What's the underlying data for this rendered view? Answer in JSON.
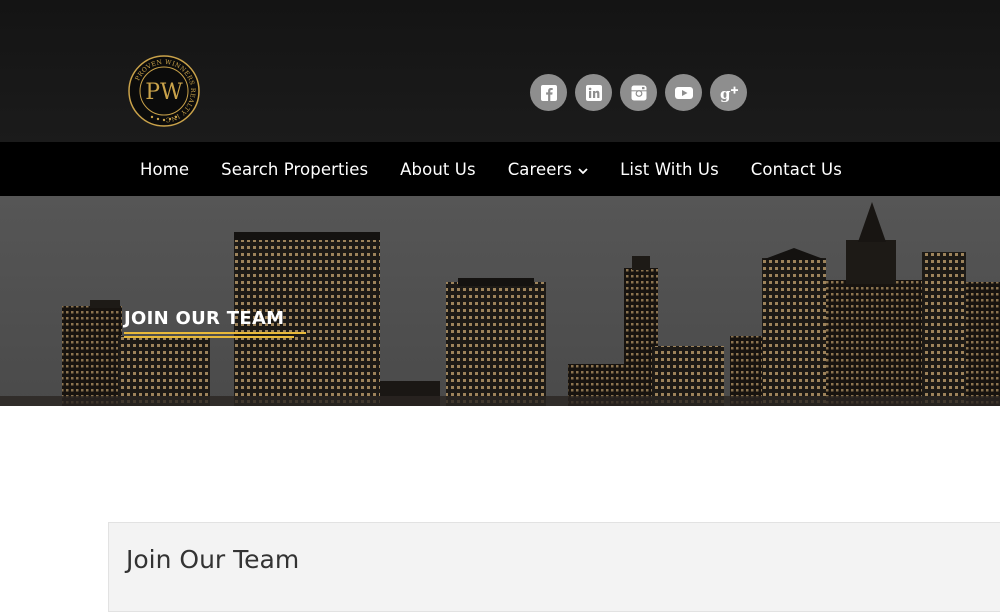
{
  "brand": {
    "logo_initials": "PW",
    "logo_ring_text": "PROVEN WINNERS REALTY",
    "logo_ring_suffix": "INC",
    "gold": "#c9a24a"
  },
  "social": [
    {
      "icon": "facebook-icon",
      "glyph": "f"
    },
    {
      "icon": "linkedin-icon",
      "glyph": "in"
    },
    {
      "icon": "instagram-icon",
      "glyph": ""
    },
    {
      "icon": "youtube-icon",
      "glyph": ""
    },
    {
      "icon": "google-plus-icon",
      "glyph": "g+"
    }
  ],
  "nav": {
    "items": [
      {
        "label": "Home"
      },
      {
        "label": "Search Properties"
      },
      {
        "label": "About Us"
      },
      {
        "label": "Careers",
        "has_dropdown": true
      },
      {
        "label": "List With Us"
      },
      {
        "label": "Contact Us"
      }
    ]
  },
  "hero": {
    "title": "JOIN OUR TEAM",
    "accent": "#e8b93a"
  },
  "content": {
    "heading": "Join Our Team"
  }
}
